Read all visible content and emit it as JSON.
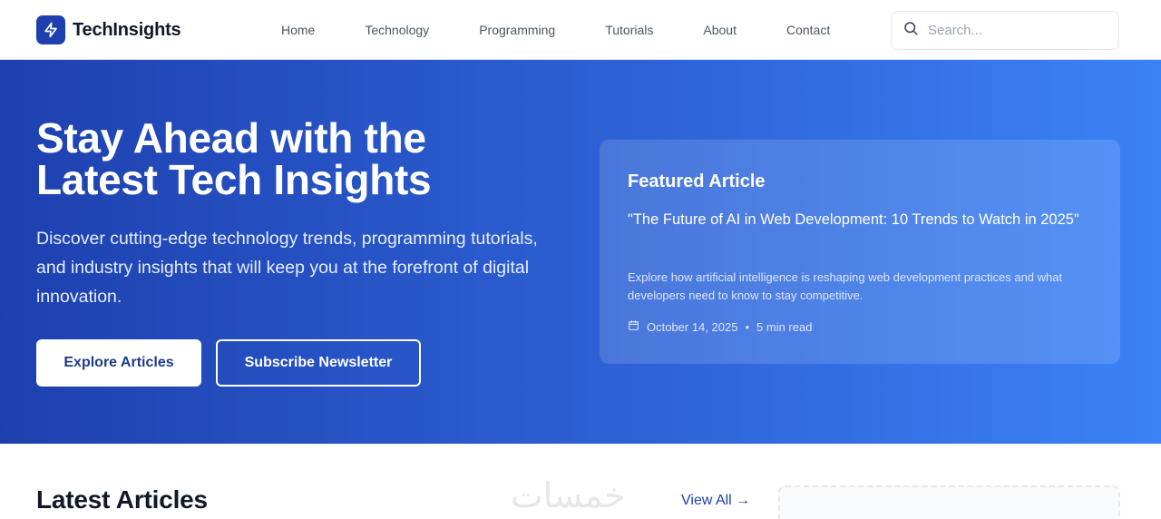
{
  "brand": {
    "name": "TechInsights",
    "accent": "#1e40af",
    "logo_icon": "lightning-bolt-icon"
  },
  "nav": {
    "items": [
      {
        "label": "Home"
      },
      {
        "label": "Technology"
      },
      {
        "label": "Programming"
      },
      {
        "label": "Tutorials"
      },
      {
        "label": "About"
      },
      {
        "label": "Contact"
      }
    ]
  },
  "search": {
    "placeholder": "Search...",
    "value": "",
    "icon": "search-icon"
  },
  "hero": {
    "title": "Stay Ahead with the Latest Tech Insights",
    "subtitle": "Discover cutting-edge technology trends, programming tutorials, and industry insights that will keep you at the forefront of digital innovation.",
    "primary_button": "Explore Articles",
    "secondary_button": "Subscribe Newsletter",
    "gradient_start": "#1e40af",
    "gradient_end": "#3b82f6"
  },
  "featured": {
    "heading": "Featured Article",
    "title": "\"The Future of AI in Web Development: 10 Trends to Watch in 2025\"",
    "description": "Explore how artificial intelligence is reshaping web development practices and what developers need to know to stay competitive.",
    "date": "October 14, 2025",
    "separator": "•",
    "read_time": "5 min read",
    "date_icon": "calendar-icon"
  },
  "latest": {
    "title": "Latest Articles",
    "view_all": "View All →",
    "watermark": "خمسات"
  }
}
